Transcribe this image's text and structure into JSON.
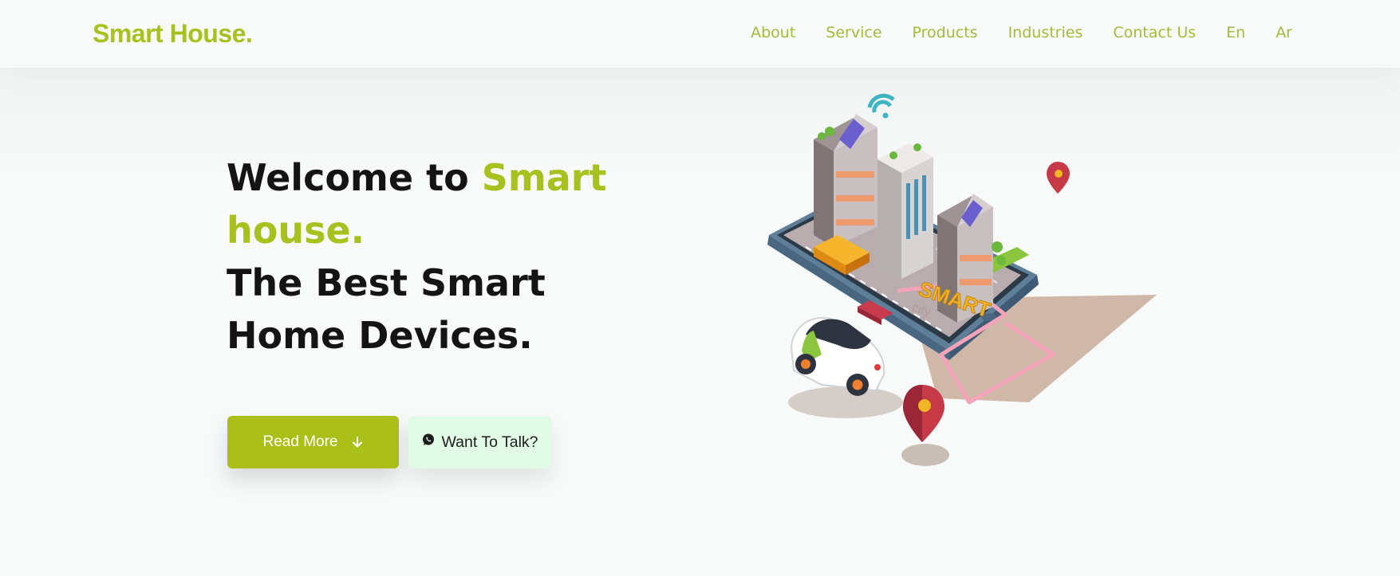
{
  "brand": {
    "logo_text": "Smart House.",
    "accent_color": "#a9c11f"
  },
  "nav": {
    "links": [
      "About",
      "Service",
      "Products",
      "Industries",
      "Contact Us",
      "En",
      "Ar"
    ]
  },
  "hero": {
    "headline_prefix": "Welcome to ",
    "headline_accent": "Smart house.",
    "subheadline": "The Best Smart Home Devices.",
    "read_more_label": "Read More",
    "read_more_icon": "arrow-down-icon",
    "talk_label": "Want To Talk?",
    "talk_icon": "whatsapp-icon"
  },
  "illustration": {
    "sign_text": "SMART",
    "sign_subtext": "city"
  }
}
